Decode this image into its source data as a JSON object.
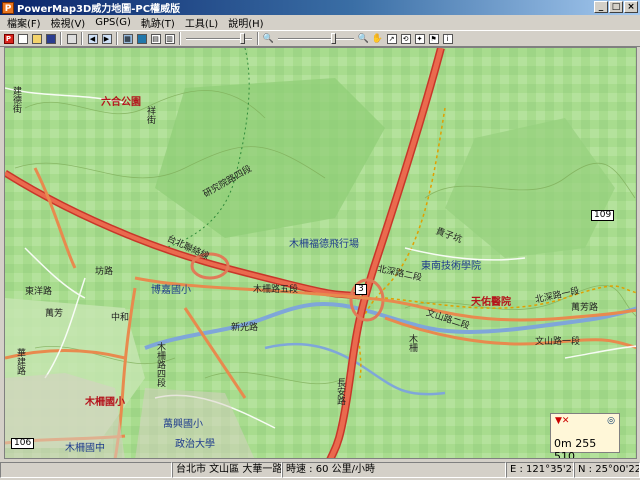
{
  "window": {
    "app_icon": "P",
    "title": "PowerMap3D威力地圖-PC權威版",
    "buttons": [
      "_",
      "□",
      "×"
    ]
  },
  "menu": [
    "檔案(F)",
    "檢視(V)",
    "GPS(G)",
    "軌跡(T)",
    "工具(L)",
    "說明(H)"
  ],
  "toolbar": {
    "icons": [
      "app-logo-icon",
      "new-file-icon",
      "open-folder-icon",
      "save-icon",
      "print-icon",
      "nav-back-icon",
      "nav-forward-icon",
      "layers-icon",
      "monitor-icon",
      "grid-icon",
      "table-icon",
      "zoom-out-icon",
      "zoom-in-icon",
      "pan-hand-icon",
      "route-icon",
      "rotate-icon",
      "compass-icon",
      "flag-icon",
      "info-icon"
    ],
    "slider_levels": [
      0.85,
      0.72
    ]
  },
  "map": {
    "labels": {
      "liuhe_park": "六合公園",
      "jian_street": "建德街",
      "xiang_street": "祥街",
      "research_road": "研究院路四段",
      "taipei_tunnel": "台北聯絡線",
      "zhamu_road5": "木柵路五段",
      "zhamu_road4": "木柵路四段",
      "zhamu_park": "木柵國小",
      "boya_park": "博嘉國小",
      "wanxing_park": "萬興國小",
      "chengchi_univ": "政治大學",
      "zhamu_middle": "木柵國中",
      "wenshan_road2": "文山路二段",
      "wenshan_road1": "文山路一段",
      "beishen_road2": "北深路二段",
      "beishen_road1": "北深路一段",
      "tianyou_hospital": "天佑醫院",
      "donan_tech": "東南技術學院",
      "zhamu_hill": "木柵福德飛行場",
      "wangfu_road": "萬芳路",
      "fangzhi_road": "坊路",
      "dongfang_road": "東洋路",
      "xian_road": "新光路",
      "changan_road": "長安路",
      "huajian_road": "華建路",
      "route_3": "3",
      "route_106": "106",
      "route_109": "109",
      "zhonghe": "中和",
      "wanqi": "萬芳",
      "muzha_nanbei": "木柵",
      "guizhi": "貴子坑"
    }
  },
  "scale": {
    "marker": "▼✕",
    "compass": "◎",
    "readout": "0m 255 510"
  },
  "status": {
    "address": "台北市 文山區 大華一路",
    "speed": "時速 : 60 公里/小時",
    "lon": "E : 121°35'28.4\"",
    "lat": "N : 25°00'22.0\""
  }
}
